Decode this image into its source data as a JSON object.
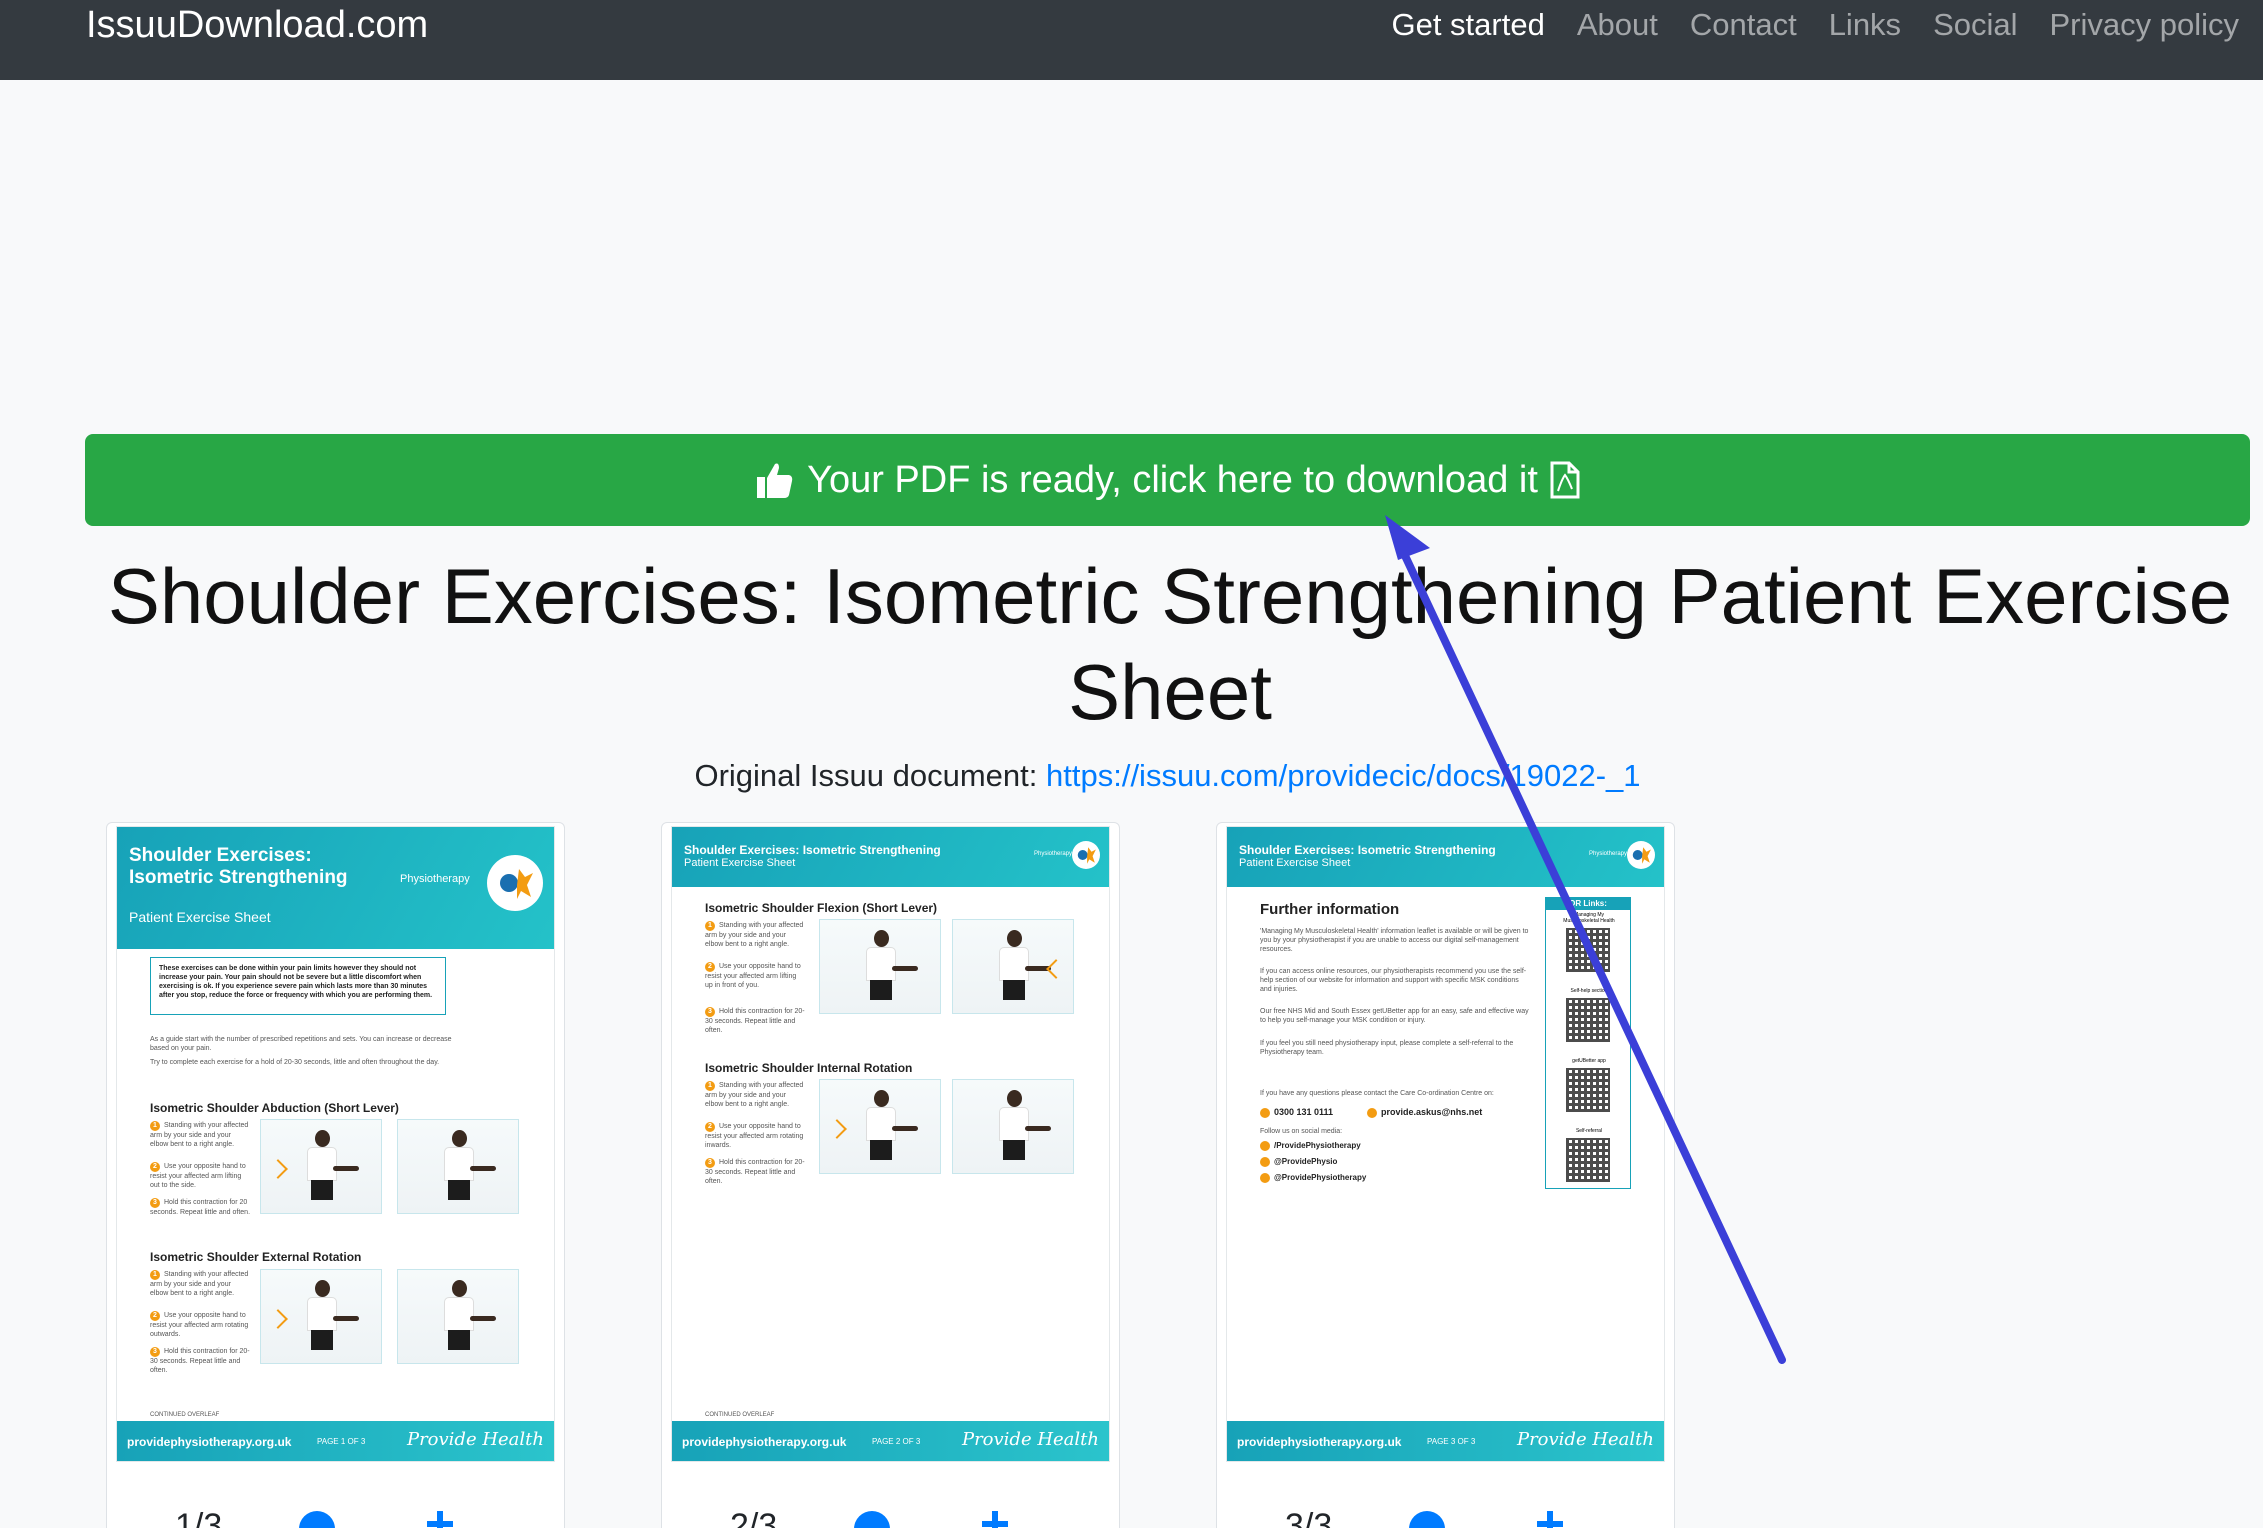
{
  "navbar": {
    "brand": "IssuuDownload.com",
    "links": [
      "Get started",
      "About",
      "Contact",
      "Links",
      "Social",
      "Privacy policy"
    ]
  },
  "banner": {
    "label": "Your PDF is ready, click here to download it"
  },
  "document": {
    "title": "Shoulder Exercises: Isometric Strengthening Patient Exercise Sheet",
    "original_label": "Original Issuu document:",
    "original_url": "https://issuu.com/providecic/docs/19022-_1"
  },
  "pages": [
    {
      "num": "1/3",
      "header_title": "Shoulder Exercises: Isometric Strengthening",
      "header_sub": "Patient Exercise Sheet",
      "brand": "Physiotherapy",
      "info": "These exercises can be done within your pain limits however they should not increase your pain. Your pain should not be severe but a little discomfort when exercising is ok. If you experience severe pain which lasts more than 30 minutes after you stop, reduce the force or frequency with which you are performing them.",
      "intro1": "As a guide start with the number of prescribed repetitions and sets. You can increase or decrease based on your pain.",
      "intro2": "Try to complete each exercise for a hold of 20-30 seconds, little and often throughout the day.",
      "sections": [
        {
          "title": "Isometric Shoulder Abduction (Short Lever)",
          "steps": [
            "Standing with your affected arm by your side and your elbow bent to a right angle.",
            "Use your opposite hand to resist your affected arm lifting out to the side.",
            "Hold this contraction for 20 seconds. Repeat little and often."
          ]
        },
        {
          "title": "Isometric Shoulder External Rotation",
          "steps": [
            "Standing with your affected arm by your side and your elbow bent to a right angle.",
            "Use your opposite hand to resist your affected arm rotating outwards.",
            "Hold this contraction for 20-30 seconds. Repeat little and often."
          ]
        }
      ],
      "continued": "CONTINUED OVERLEAF",
      "site": "providephysiotherapy.org.uk",
      "page_label": "PAGE 1 OF 3",
      "logo": "Provide Health"
    },
    {
      "num": "2/3",
      "header_title": "Shoulder Exercises: Isometric Strengthening",
      "header_sub": "Patient Exercise Sheet",
      "brand": "Physiotherapy",
      "sections": [
        {
          "title": "Isometric Shoulder Flexion (Short Lever)",
          "steps": [
            "Standing with your affected arm by your side and your elbow bent to a right angle.",
            "Use your opposite hand to resist your affected arm lifting up in front of you.",
            "Hold this contraction for 20-30 seconds. Repeat little and often."
          ]
        },
        {
          "title": "Isometric Shoulder Internal Rotation",
          "steps": [
            "Standing with your affected arm by your side and your elbow bent to a right angle.",
            "Use your opposite hand to resist your affected arm rotating inwards.",
            "Hold this contraction for 20-30 seconds. Repeat little and often."
          ]
        }
      ],
      "continued": "CONTINUED OVERLEAF",
      "site": "providephysiotherapy.org.uk",
      "page_label": "PAGE 2 OF 3",
      "logo": "Provide Health"
    },
    {
      "num": "3/3",
      "header_title": "Shoulder Exercises: Isometric Strengthening",
      "header_sub": "Patient Exercise Sheet",
      "brand": "Physiotherapy",
      "further_title": "Further information",
      "para1": "'Managing My Musculoskeletal Health' information leaflet is available or will be given to you by your physiotherapist if you are unable to access our digital self-management resources.",
      "para2": "If you can access online resources, our physiotherapists recommend you use the self-help section of our website for information and support with specific MSK conditions and injuries.",
      "para3": "Our free NHS Mid and South Essex getUBetter app for an easy, safe and effective way to help you self-manage your MSK condition or injury.",
      "para4": "If you feel you still need physiotherapy input, please complete a self-referral to the Physiotherapy team.",
      "questions": "If you have any questions please contact the Care Co-ordination Centre on:",
      "phone": "0300 131 0111",
      "email": "provide.askus@nhs.net",
      "social_label": "Follow us on social media:",
      "social": [
        "/ProvidePhysiotherapy",
        "@ProvidePhysio",
        "@ProvidePhysiotherapy"
      ],
      "qr_head": "QR Links:",
      "qr_labels": [
        "Managing My Musculoskeletal Health",
        "Self-help section",
        "getUBetter app",
        "Self-referral"
      ],
      "site": "providephysiotherapy.org.uk",
      "page_label": "PAGE 3 OF 3",
      "logo": "Provide Health"
    }
  ],
  "colors": {
    "banner": "#28a745",
    "navbar": "#343a40",
    "link": "#007bff",
    "teal": "#17a2b8",
    "annotation_arrow": "#3b3fd8"
  }
}
